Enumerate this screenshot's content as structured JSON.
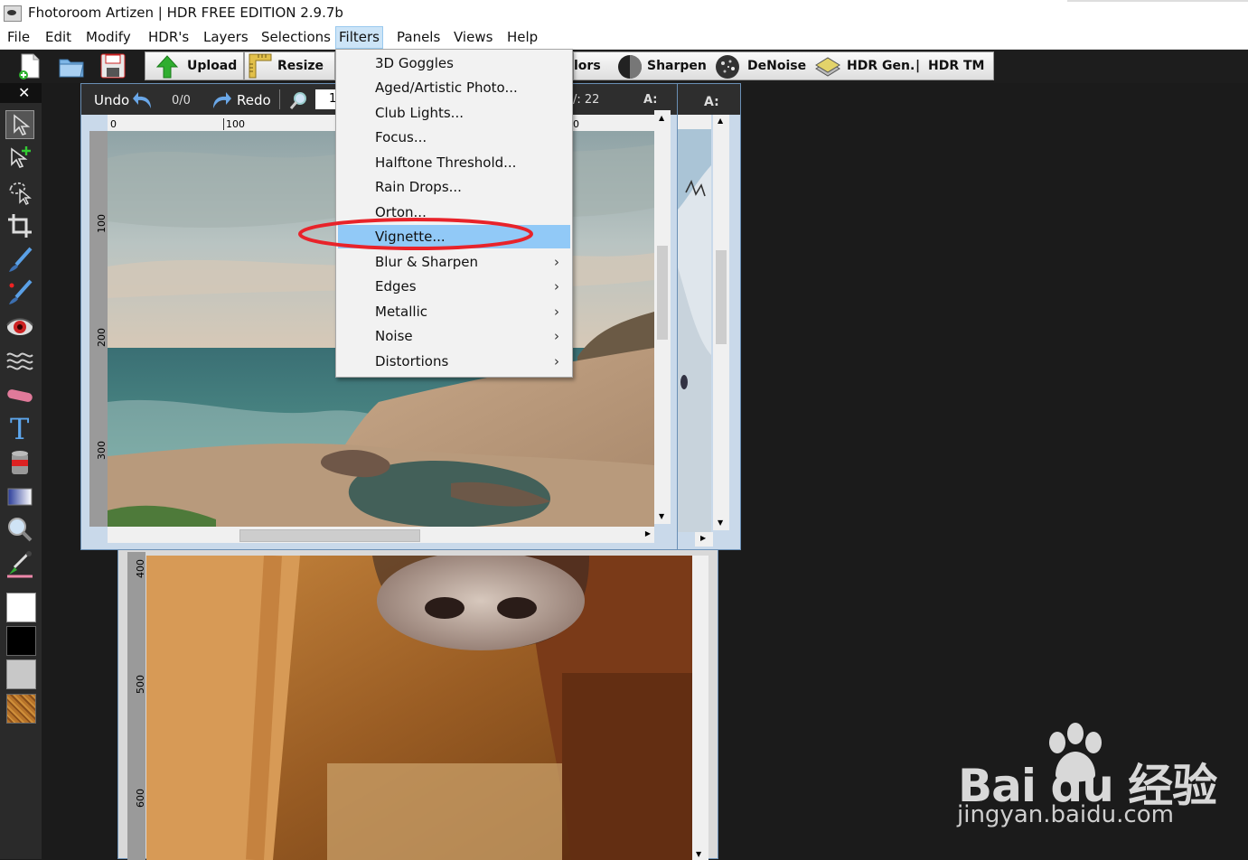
{
  "window": {
    "title": "Fhotoroom Artizen | HDR FREE EDITION 2.9.7b"
  },
  "menubar": [
    {
      "label": "File"
    },
    {
      "label": "Edit"
    },
    {
      "label": "Modify"
    },
    {
      "label": "HDR's"
    },
    {
      "label": "Layers"
    },
    {
      "label": "Selections"
    },
    {
      "label": "Filters",
      "active": true
    },
    {
      "label": "Panels"
    },
    {
      "label": "Views"
    },
    {
      "label": "Help"
    }
  ],
  "toolbar": {
    "upload_label": "Upload",
    "resize_label": "Resize",
    "colors_label": "lors",
    "sharpen_label": "Sharpen",
    "denoise_label": "DeNoise",
    "hdr_gen_label": "HDR Gen.",
    "separator": "|",
    "hdr_tm_label": "HDR TM"
  },
  "left_panel": {
    "close_glyph": "✕"
  },
  "front_window": {
    "undo_label": "Undo",
    "counter": "0/0",
    "redo_label": "Redo",
    "zoom_value": "1",
    "y_readout": "/: 22",
    "a_label": "A:",
    "ruler_h": [
      "0",
      "100"
    ],
    "ruler_h2": "0",
    "ruler_v": [
      "100",
      "200",
      "300"
    ]
  },
  "back_window": {
    "a_label": "A:"
  },
  "third_window": {
    "ruler_v": [
      "400",
      "500",
      "600"
    ]
  },
  "filters_menu": {
    "items": [
      {
        "label": "3D Goggles",
        "submenu": false
      },
      {
        "label": "Aged/Artistic Photo...",
        "submenu": false
      },
      {
        "label": "Club Lights...",
        "submenu": false
      },
      {
        "label": "Focus...",
        "submenu": false
      },
      {
        "label": "Halftone Threshold...",
        "submenu": false
      },
      {
        "label": "Rain Drops...",
        "submenu": false
      },
      {
        "label": "Orton...",
        "submenu": false
      },
      {
        "label": "Vignette...",
        "submenu": false,
        "highlighted": true
      },
      {
        "label": "Blur & Sharpen",
        "submenu": true
      },
      {
        "label": "Edges",
        "submenu": true
      },
      {
        "label": "Metallic",
        "submenu": true
      },
      {
        "label": "Noise",
        "submenu": true
      },
      {
        "label": "Distortions",
        "submenu": true
      }
    ],
    "submenu_glyph": "›"
  },
  "watermark": {
    "brand": "Bai du 经验",
    "url": "jingyan.baidu.com"
  },
  "colors": {
    "highlight": "#91c9f7",
    "annotation_ellipse": "#e8232a",
    "foreground_swatch": "#ffffff",
    "background_swatch": "#000000",
    "gray_swatch": "#c8c8c8",
    "texture_swatch": "#b8742a"
  }
}
